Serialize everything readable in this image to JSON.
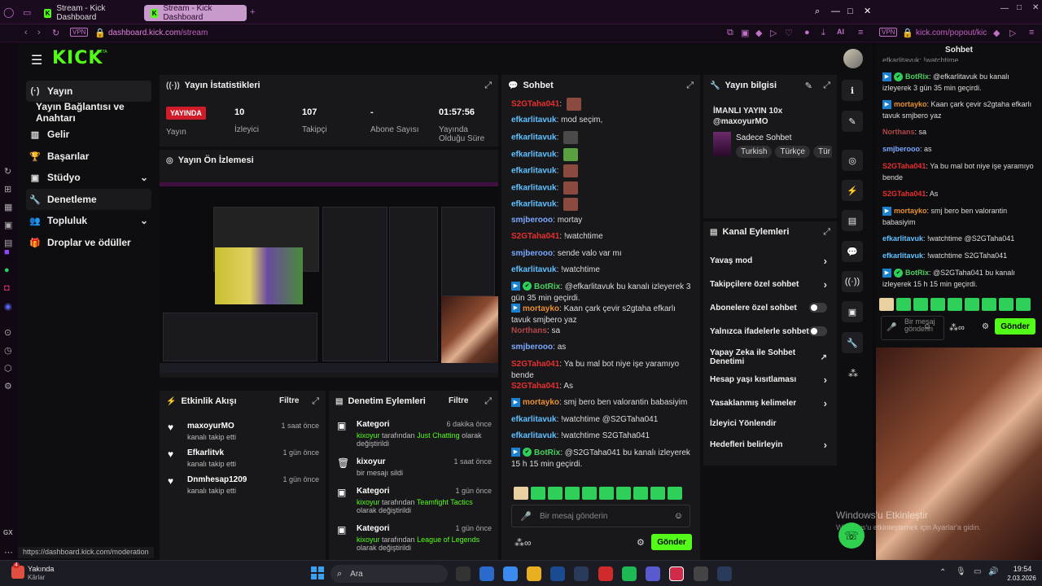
{
  "browser": {
    "tabs": [
      {
        "label": "Stream - Kick Dashboard"
      },
      {
        "label": "Stream - Kick Dashboard"
      }
    ],
    "url_host": "dashboard.kick.com",
    "url_path": "/stream",
    "url_prefix": "",
    "vpn": "VPN",
    "ai": "AI",
    "popout_url": "kick.com/popout/kic",
    "status_url": "https://dashboard.kick.com/moderation"
  },
  "brand": {
    "logo": "KICK",
    "beta": "BETA"
  },
  "nav": {
    "items": [
      {
        "label": "Yayın",
        "icon": "broadcast-icon"
      },
      {
        "label": "Yayın Bağlantısı ve Anahtarı",
        "icon": ""
      },
      {
        "label": "Gelir",
        "icon": "revenue-icon"
      },
      {
        "label": "Başarılar",
        "icon": "trophy-icon"
      },
      {
        "label": "Stüdyo",
        "icon": "studio-icon"
      },
      {
        "label": "Denetleme",
        "icon": "wrench-icon"
      },
      {
        "label": "Topluluk",
        "icon": "community-icon"
      },
      {
        "label": "Droplar ve ödüller",
        "icon": "gift-icon"
      }
    ]
  },
  "stats": {
    "title": "Yayın İstatistikleri",
    "live_badge": "YAYINDA",
    "live_label": "Yayın",
    "viewers": {
      "value": "10",
      "label": "İzleyici"
    },
    "followers": {
      "value": "107",
      "label": "Takipçi"
    },
    "subs": {
      "value": "-",
      "label": "Abone Sayısı"
    },
    "uptime": {
      "value": "01:57:56",
      "label": "Yayında Olduğu Süre"
    }
  },
  "preview": {
    "title": "Yayın Ön İzlemesi"
  },
  "activity": {
    "title": "Etkinlik Akışı",
    "filter": "Filtre",
    "items": [
      {
        "user": "maxoyurMO",
        "text": "kanalı takip etti",
        "time": "1 saat önce"
      },
      {
        "user": "Efkarlitvk",
        "text": "kanalı takip etti",
        "time": "1 gün önce"
      },
      {
        "user": "Dnmhesap1209",
        "text": "kanalı takip etti",
        "time": "1 gün önce"
      }
    ]
  },
  "modactions": {
    "title": "Denetim Eylemleri",
    "filter": "Filtre",
    "items": [
      {
        "title": "Kategori",
        "time": "6 dakika önce",
        "actor": "kixoyur",
        "mid": " tarafından ",
        "target": "Just Chatting",
        "tail": " olarak değiştirildi"
      },
      {
        "title": "kixoyur",
        "time": "1 saat önce",
        "line": "bir mesajı sildi"
      },
      {
        "title": "Kategori",
        "time": "1 gün önce",
        "actor": "kixoyur",
        "mid": " tarafından ",
        "target": "Teamfight Tactics",
        "tail": " olarak değiştirildi"
      },
      {
        "title": "Kategori",
        "time": "1 gün önce",
        "actor": "kixoyur",
        "mid": " tarafından ",
        "target": "League of Legends",
        "tail": " olarak değiştirildi"
      }
    ]
  },
  "chat": {
    "title": "Sohbet",
    "placeholder": "Bir mesaj gönderin",
    "send": "Gönder",
    "messages": [
      {
        "user": "S2GTaha041",
        "cls": "u-r",
        "text": ""
      },
      {
        "user": "efkarlitavuk",
        "cls": "u-g",
        "text": "mod seçim,"
      },
      {
        "user": "efkarlitavuk",
        "cls": "u-g",
        "text": ""
      },
      {
        "user": "efkarlitavuk",
        "cls": "u-g",
        "text": ""
      },
      {
        "user": "efkarlitavuk",
        "cls": "u-g",
        "text": ""
      },
      {
        "user": "efkarlitavuk",
        "cls": "u-g",
        "text": ""
      },
      {
        "user": "efkarlitavuk",
        "cls": "u-g",
        "text": ""
      },
      {
        "user": "smjberooo",
        "cls": "u-b",
        "text": "mortay"
      },
      {
        "user": "S2GTaha041",
        "cls": "u-r",
        "text": "!watchtime"
      },
      {
        "user": "smjberooo",
        "cls": "u-b",
        "text": "sende valo var mı"
      },
      {
        "user": "efkarlitavuk",
        "cls": "u-g",
        "text": "!watchtime"
      },
      {
        "user": "BotRix",
        "cls": "u-bot",
        "text": "@efkarlitavuk bu kanalı izleyerek 3 gün 35 min geçirdi."
      },
      {
        "user": "mortayko",
        "cls": "u-o",
        "text": "Kaan çark çevir s2gtaha efkarlı tavuk smjbero yaz"
      },
      {
        "user": "Northans",
        "cls": "u-br",
        "text": "sa"
      },
      {
        "user": "smjberooo",
        "cls": "u-b",
        "text": "as"
      },
      {
        "user": "S2GTaha041",
        "cls": "u-r",
        "text": "Ya bu mal bot niye işe yaramıyo bende"
      },
      {
        "user": "S2GTaha041",
        "cls": "u-r",
        "text": "As"
      },
      {
        "user": "mortayko",
        "cls": "u-o",
        "text": "smj bero ben valorantin babasiyim"
      },
      {
        "user": "efkarlitavuk",
        "cls": "u-g",
        "text": "!watchtime @S2GTaha041"
      },
      {
        "user": "efkarlitavuk",
        "cls": "u-g",
        "text": "!watchtime S2GTaha041"
      },
      {
        "user": "BotRix",
        "cls": "u-bot",
        "text": "@S2GTaha041 bu kanalı izleyerek 15 h 15 min geçirdi."
      }
    ]
  },
  "info": {
    "title": "Yayın bilgisi",
    "stream_title": "İMANLI YAYIN 10x @maxoyurMO",
    "category": "Sadece Sohbet",
    "tags": [
      "Turkish",
      "Türkçe",
      "Tür"
    ]
  },
  "channel": {
    "title": "Kanal Eylemleri",
    "items": [
      {
        "label": "Yavaş mod",
        "type": "arrow"
      },
      {
        "label": "Takipçilere özel sohbet",
        "type": "arrow"
      },
      {
        "label": "Abonelere özel sohbet",
        "type": "toggle"
      },
      {
        "label": "Yalnızca ifadelerle sohbet",
        "type": "toggle"
      },
      {
        "label": "Yapay Zeka ile Sohbet Denetimi",
        "type": "ext"
      },
      {
        "label": "Hesap yaşı kısıtlaması",
        "type": "arrow"
      },
      {
        "label": "Yasaklanmış kelimeler",
        "type": "arrow"
      },
      {
        "label": "İzleyici Yönlendir",
        "type": "none"
      },
      {
        "label": "Hedefleri belirleyin",
        "type": "arrow"
      }
    ]
  },
  "popout": {
    "title": "Sohbet",
    "placeholder": "Bir mesaj gönderin",
    "send": "Gönder",
    "top_cut": "efkarlitavuk: !watchtime",
    "messages": [
      {
        "user": "BotRix",
        "cls": "u-bot",
        "text": "@efkarlitavuk bu kanalı izleyerek 3 gün 35 min geçirdi."
      },
      {
        "user": "mortayko",
        "cls": "u-o",
        "text": "Kaan çark çevir s2gtaha efkarlı tavuk smjbero yaz"
      },
      {
        "user": "Northans",
        "cls": "u-br",
        "text": "sa"
      },
      {
        "user": "smjberooo",
        "cls": "u-b",
        "text": "as"
      },
      {
        "user": "S2GTaha041",
        "cls": "u-r",
        "text": "Ya bu mal bot niye işe yaramıyo bende"
      },
      {
        "user": "S2GTaha041",
        "cls": "u-r",
        "text": "As"
      },
      {
        "user": "mortayko",
        "cls": "u-o",
        "text": "smj bero ben valorantin babasiyim"
      },
      {
        "user": "efkarlitavuk",
        "cls": "u-g",
        "text": "!watchtime @S2GTaha041"
      },
      {
        "user": "efkarlitavuk",
        "cls": "u-g",
        "text": "!watchtime S2GTaha041"
      },
      {
        "user": "BotRix",
        "cls": "u-bot",
        "text": "@S2GTaha041 bu kanalı izleyerek 15 h 15 min geçirdi."
      }
    ]
  },
  "watermark": {
    "line1": "Windows'u Etkinleştir",
    "line2": "Windows'u etkinleştirmek için Ayarlar'a gidin."
  },
  "taskbar": {
    "weather_title": "Yakında",
    "weather_sub": "Kârlar",
    "weather_badge": "4",
    "search": "Ara",
    "time": "19:54",
    "date": "2.03.2026"
  },
  "opera": {
    "gx": "GX"
  },
  "colors": {
    "accent": "#53fc18",
    "live": "#d01b2a",
    "chrome": "#c060c0"
  }
}
